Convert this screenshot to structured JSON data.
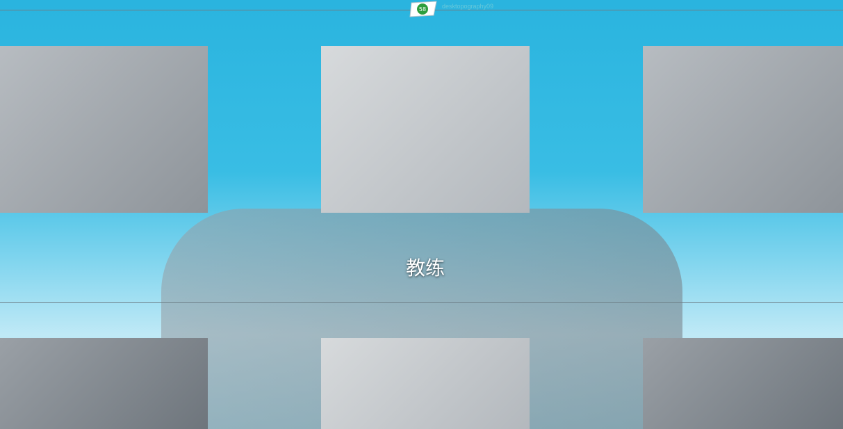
{
  "header": {
    "logo_text": "58",
    "watermark_text": "desktopography09"
  },
  "section": {
    "caption": "教练"
  },
  "gallery": {
    "row1": [
      {
        "name": "parkour-photo-group-jump"
      },
      {
        "name": "parkour-photo-wall-sequence"
      },
      {
        "name": "parkour-photo-london-bridge"
      }
    ],
    "row2": [
      {
        "name": "coach-photo-gym-man"
      },
      {
        "name": "coach-photo-hooded-man"
      },
      {
        "name": "coach-photo-fitness-woman"
      }
    ]
  },
  "colors": {
    "sky": "#2ab4df",
    "caption_text": "#ffffff"
  }
}
